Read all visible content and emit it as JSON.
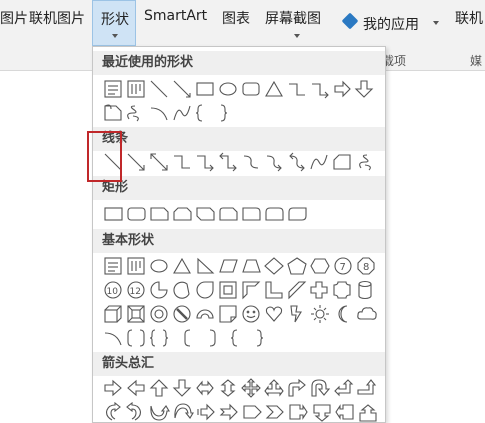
{
  "ribbon": {
    "pictures_partial": "图片",
    "online_pictures": "联机图片",
    "shapes": "形状",
    "smartart": "SmartArt",
    "chart": "图表",
    "screenshot": "屏幕截图",
    "my_apps": "我的应用",
    "online_partial": "联机",
    "addins_group_partial": "载项",
    "media_group_partial": "媒"
  },
  "sections": {
    "recent": "最近使用的形状",
    "lines": "线条",
    "rectangles": "矩形",
    "basic": "基本形状",
    "arrows": "箭头总汇"
  },
  "colors": {
    "selected_tab_bg": "#cfe3f5",
    "highlight": "#c0282a",
    "app_icon": "#2b79c2"
  }
}
